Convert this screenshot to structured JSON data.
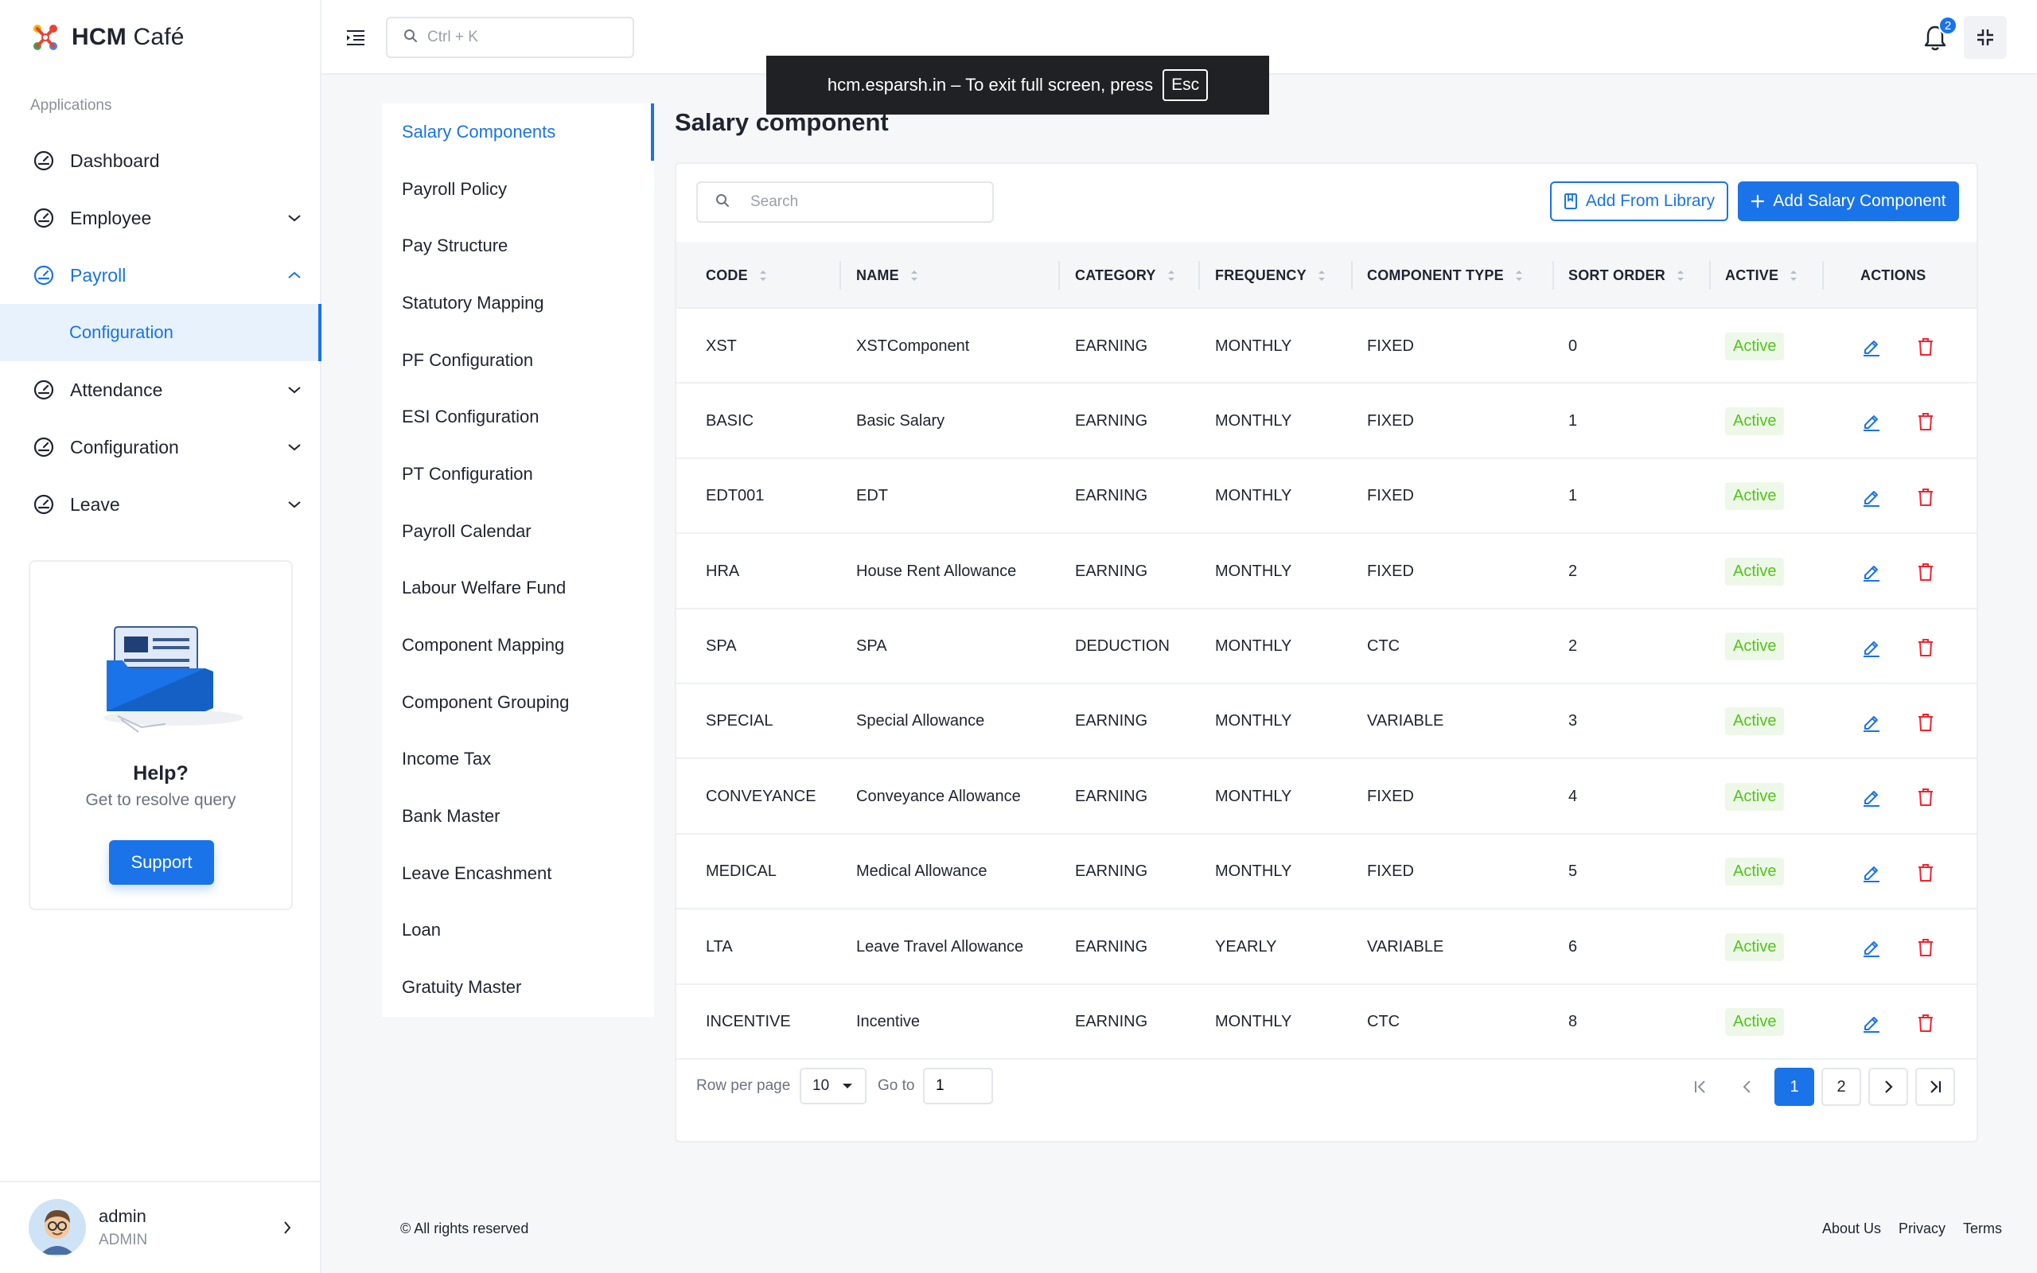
{
  "brand": {
    "name_bold": "HCM",
    "name_regular": " Café"
  },
  "sidebar": {
    "section_label": "Applications",
    "items": [
      {
        "label": "Dashboard",
        "expandable": false
      },
      {
        "label": "Employee",
        "expandable": true
      },
      {
        "label": "Payroll",
        "expandable": true,
        "open": true
      },
      {
        "label": "Configuration",
        "sub": true
      },
      {
        "label": "Attendance",
        "expandable": true
      },
      {
        "label": "Configuration",
        "expandable": true
      },
      {
        "label": "Leave",
        "expandable": true
      }
    ],
    "help": {
      "title": "Help?",
      "subtitle": "Get to resolve query",
      "button": "Support"
    },
    "user": {
      "name": "admin",
      "role": "ADMIN"
    }
  },
  "header": {
    "search_placeholder": "Ctrl + K",
    "notification_count": "2"
  },
  "fullscreen_toast": {
    "text": "hcm.esparsh.in – To exit full screen, press",
    "key": "Esc"
  },
  "config_menu": {
    "items": [
      "Salary Components",
      "Payroll Policy",
      "Pay Structure",
      "Statutory Mapping",
      "PF Configuration",
      "ESI Configuration",
      "PT Configuration",
      "Payroll Calendar",
      "Labour Welfare Fund",
      "Component Mapping",
      "Component Grouping",
      "Income Tax",
      "Bank Master",
      "Leave Encashment",
      "Loan",
      "Gratuity Master"
    ],
    "active_index": 0
  },
  "main": {
    "title": "Salary component",
    "search_placeholder": "Search",
    "add_from_library": "Add From Library",
    "add_component": "Add Salary Component",
    "columns": [
      "CODE",
      "NAME",
      "CATEGORY",
      "FREQUENCY",
      "COMPONENT TYPE",
      "SORT ORDER",
      "ACTIVE",
      "ACTIONS"
    ],
    "rows": [
      {
        "code": "XST",
        "name": "XSTComponent",
        "category": "EARNING",
        "frequency": "MONTHLY",
        "type": "FIXED",
        "sort": "0",
        "active": "Active"
      },
      {
        "code": "BASIC",
        "name": "Basic Salary",
        "category": "EARNING",
        "frequency": "MONTHLY",
        "type": "FIXED",
        "sort": "1",
        "active": "Active"
      },
      {
        "code": "EDT001",
        "name": "EDT",
        "category": "EARNING",
        "frequency": "MONTHLY",
        "type": "FIXED",
        "sort": "1",
        "active": "Active"
      },
      {
        "code": "HRA",
        "name": "House Rent Allowance",
        "category": "EARNING",
        "frequency": "MONTHLY",
        "type": "FIXED",
        "sort": "2",
        "active": "Active"
      },
      {
        "code": "SPA",
        "name": "SPA",
        "category": "DEDUCTION",
        "frequency": "MONTHLY",
        "type": "CTC",
        "sort": "2",
        "active": "Active"
      },
      {
        "code": "SPECIAL",
        "name": "Special Allowance",
        "category": "EARNING",
        "frequency": "MONTHLY",
        "type": "VARIABLE",
        "sort": "3",
        "active": "Active"
      },
      {
        "code": "CONVEYANCE",
        "name": "Conveyance Allowance",
        "category": "EARNING",
        "frequency": "MONTHLY",
        "type": "FIXED",
        "sort": "4",
        "active": "Active"
      },
      {
        "code": "MEDICAL",
        "name": "Medical Allowance",
        "category": "EARNING",
        "frequency": "MONTHLY",
        "type": "FIXED",
        "sort": "5",
        "active": "Active"
      },
      {
        "code": "LTA",
        "name": "Leave Travel Allowance",
        "category": "EARNING",
        "frequency": "YEARLY",
        "type": "VARIABLE",
        "sort": "6",
        "active": "Active"
      },
      {
        "code": "INCENTIVE",
        "name": "Incentive",
        "category": "EARNING",
        "frequency": "MONTHLY",
        "type": "CTC",
        "sort": "8",
        "active": "Active"
      }
    ],
    "pagination": {
      "rows_label": "Row per page",
      "rows_value": "10",
      "goto_label": "Go to",
      "goto_value": "1",
      "pages": [
        "1",
        "2"
      ],
      "current_page": "1"
    }
  },
  "footer": {
    "copyright": "© All rights reserved",
    "links": [
      "About Us",
      "Privacy",
      "Terms"
    ]
  },
  "colors": {
    "accent": "#1a73e8",
    "success_text": "#52c41a",
    "success_bg": "#eef8e8",
    "danger": "#f5222d"
  },
  "icons": {
    "nav": "dashboard-gauge-icon",
    "search": "search-icon",
    "menu": "menu-indent-icon",
    "notification": "bell-icon",
    "fullscreen_exit": "fullscreen-exit-icon",
    "edit": "edit-icon",
    "delete": "trash-icon",
    "library": "book-icon",
    "add": "plus-icon"
  }
}
